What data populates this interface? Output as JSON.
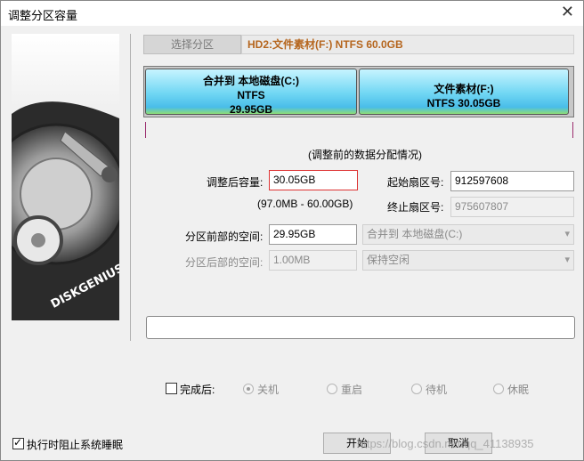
{
  "window": {
    "title": "调整分区容量"
  },
  "top": {
    "select_button": "选择分区",
    "disk_info": "HD2:文件素材(F:) NTFS 60.0GB"
  },
  "partitions": [
    {
      "line1": "合并到 本地磁盘(C:)",
      "line2": "NTFS",
      "line3": "29.95GB"
    },
    {
      "line1": "文件素材(F:)",
      "line2": "NTFS 30.05GB"
    }
  ],
  "caption": "(调整前的数据分配情况)",
  "form": {
    "resize_label": "调整后容量:",
    "resize_value": "30.05GB",
    "range_text": "(97.0MB - 60.00GB)",
    "start_sector_label": "起始扇区号:",
    "start_sector_value": "912597608",
    "end_sector_label": "终止扇区号:",
    "end_sector_value": "975607807",
    "before_space_label": "分区前部的空间:",
    "before_space_value": "29.95GB",
    "before_space_option": "合并到 本地磁盘(C:)",
    "after_space_label": "分区后部的空间:",
    "after_space_value": "1.00MB",
    "after_space_option": "保持空闲"
  },
  "after_complete": {
    "label": "完成后:",
    "options": [
      "关机",
      "重启",
      "待机",
      "休眠"
    ],
    "selected": "关机"
  },
  "prevent_sleep": {
    "label": "执行时阻止系统睡眠",
    "checked": true
  },
  "buttons": {
    "start": "开始",
    "cancel": "取消"
  },
  "illustration": {
    "brand": "DISKGENIUS"
  },
  "watermark": "https://blog.csdn.net/qq_41138935"
}
